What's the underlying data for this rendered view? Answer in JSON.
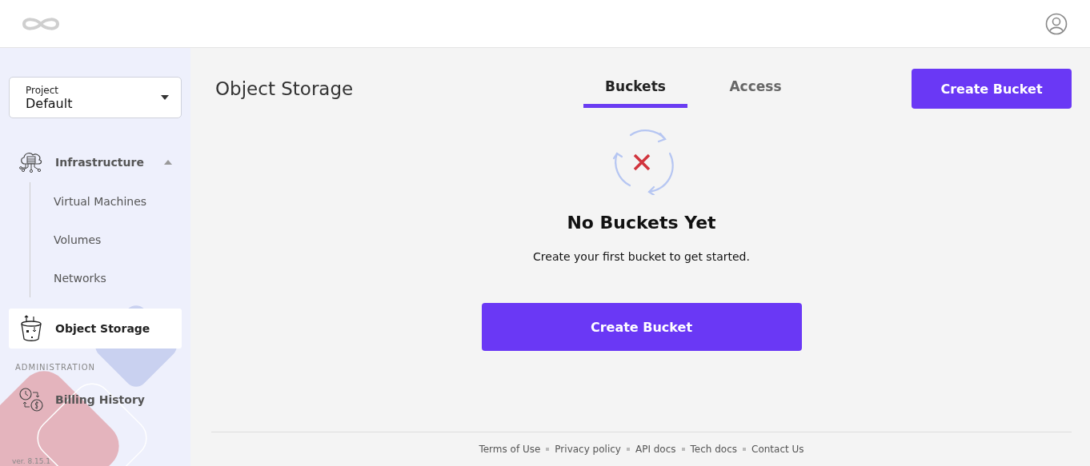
{
  "project": {
    "label": "Project",
    "value": "Default"
  },
  "nav": [
    {
      "kind": "group",
      "label": "Infrastructure",
      "expanded": true,
      "selected": false,
      "children": [
        {
          "label": "Virtual Machines",
          "selected": false
        },
        {
          "label": "Volumes",
          "selected": false
        },
        {
          "label": "Networks",
          "selected": false
        }
      ]
    },
    {
      "kind": "item",
      "label": "Object Storage",
      "selected": true
    },
    {
      "kind": "section",
      "label": "ADMINISTRATION"
    },
    {
      "kind": "item",
      "label": "Billing History",
      "selected": false
    }
  ],
  "version": "ver. 8.15.1",
  "page_title": "Object Storage",
  "tabs": [
    {
      "label": "Buckets",
      "selected": true
    },
    {
      "label": "Access",
      "selected": false
    }
  ],
  "top_button": "Create Bucket",
  "empty_state": {
    "title": "No Buckets Yet",
    "message": "Create your first bucket to get started.",
    "button": "Create Bucket"
  },
  "footer_links": [
    "Terms of Use",
    "Privacy policy",
    "API docs",
    "Tech docs",
    "Contact Us"
  ]
}
